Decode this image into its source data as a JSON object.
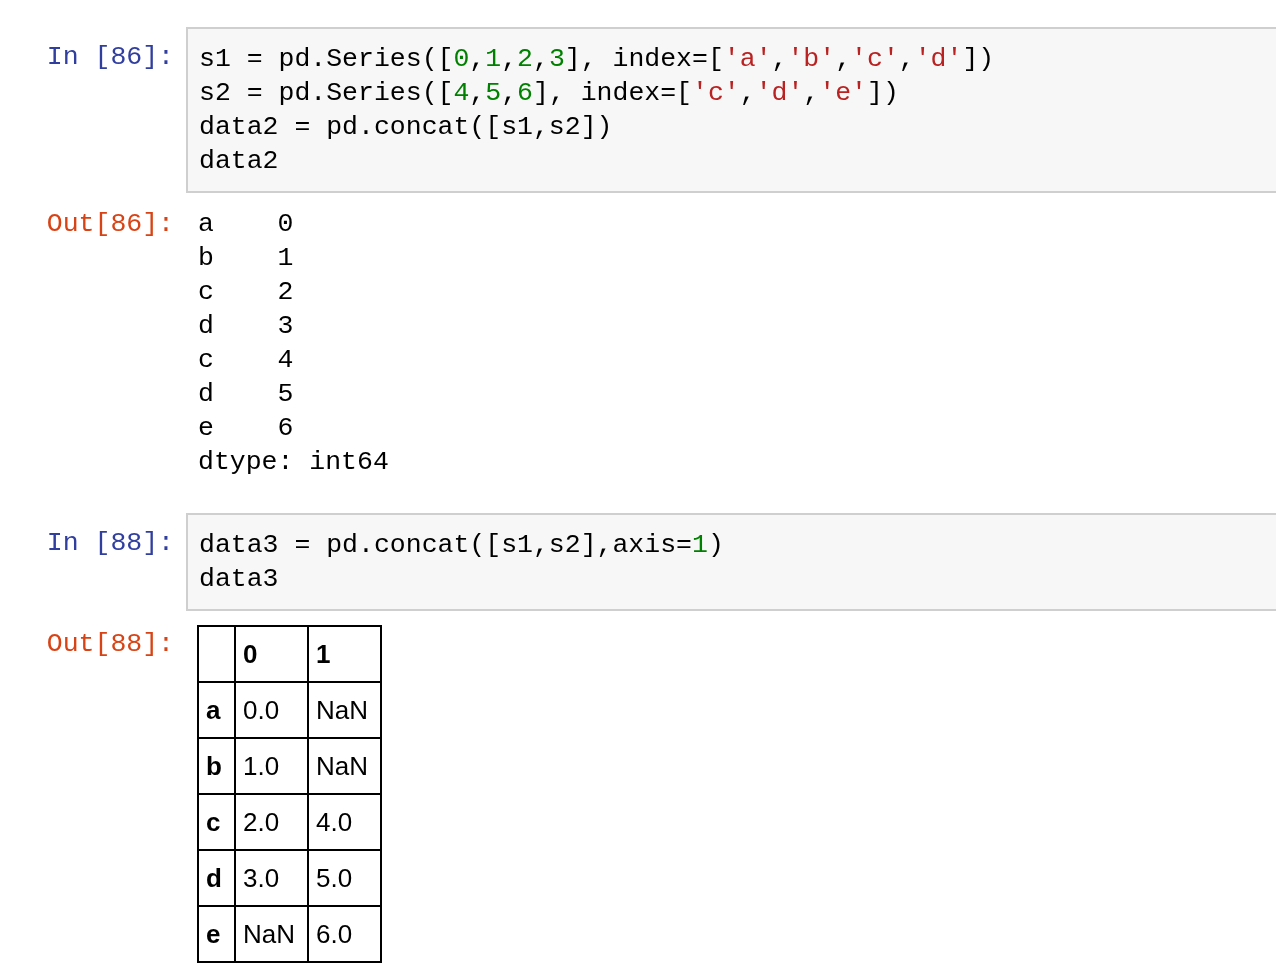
{
  "cells": [
    {
      "kind": "input",
      "prompt": "In [86]:",
      "lines": [
        [
          {
            "text": "s1 = pd.Series([",
            "kind": "plain"
          },
          {
            "text": "0",
            "kind": "number"
          },
          {
            "text": ",",
            "kind": "plain"
          },
          {
            "text": "1",
            "kind": "number"
          },
          {
            "text": ",",
            "kind": "plain"
          },
          {
            "text": "2",
            "kind": "number"
          },
          {
            "text": ",",
            "kind": "plain"
          },
          {
            "text": "3",
            "kind": "number"
          },
          {
            "text": "], index=[",
            "kind": "plain"
          },
          {
            "text": "'a'",
            "kind": "string"
          },
          {
            "text": ",",
            "kind": "plain"
          },
          {
            "text": "'b'",
            "kind": "string"
          },
          {
            "text": ",",
            "kind": "plain"
          },
          {
            "text": "'c'",
            "kind": "string"
          },
          {
            "text": ",",
            "kind": "plain"
          },
          {
            "text": "'d'",
            "kind": "string"
          },
          {
            "text": "])",
            "kind": "plain"
          }
        ],
        [
          {
            "text": "s2 = pd.Series([",
            "kind": "plain"
          },
          {
            "text": "4",
            "kind": "number"
          },
          {
            "text": ",",
            "kind": "plain"
          },
          {
            "text": "5",
            "kind": "number"
          },
          {
            "text": ",",
            "kind": "plain"
          },
          {
            "text": "6",
            "kind": "number"
          },
          {
            "text": "], index=[",
            "kind": "plain"
          },
          {
            "text": "'c'",
            "kind": "string"
          },
          {
            "text": ",",
            "kind": "plain"
          },
          {
            "text": "'d'",
            "kind": "string"
          },
          {
            "text": ",",
            "kind": "plain"
          },
          {
            "text": "'e'",
            "kind": "string"
          },
          {
            "text": "])",
            "kind": "plain"
          }
        ],
        [
          {
            "text": "data2 = pd.concat([s1,s2])",
            "kind": "plain"
          }
        ],
        [
          {
            "text": "data2",
            "kind": "plain"
          }
        ]
      ]
    },
    {
      "kind": "text_output",
      "prompt": "Out[86]:",
      "lines": [
        "a    0",
        "b    1",
        "c    2",
        "d    3",
        "c    4",
        "d    5",
        "e    6",
        "dtype: int64"
      ]
    },
    {
      "kind": "input",
      "prompt": "In [88]:",
      "lines": [
        [
          {
            "text": "data3 = pd.concat([s1,s2],axis=",
            "kind": "plain"
          },
          {
            "text": "1",
            "kind": "number"
          },
          {
            "text": ")",
            "kind": "plain"
          }
        ],
        [
          {
            "text": "data3",
            "kind": "plain"
          }
        ]
      ]
    },
    {
      "kind": "table_output",
      "prompt": "Out[88]:",
      "columns": [
        "0",
        "1"
      ],
      "rows": [
        {
          "index": "a",
          "values": [
            "0.0",
            "NaN"
          ]
        },
        {
          "index": "b",
          "values": [
            "1.0",
            "NaN"
          ]
        },
        {
          "index": "c",
          "values": [
            "2.0",
            "4.0"
          ]
        },
        {
          "index": "d",
          "values": [
            "3.0",
            "5.0"
          ]
        },
        {
          "index": "e",
          "values": [
            "NaN",
            "6.0"
          ]
        }
      ]
    }
  ]
}
